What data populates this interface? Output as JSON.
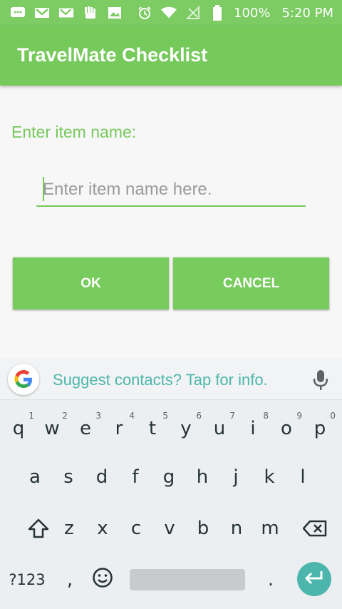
{
  "status_bar": {
    "battery_percent": "100%",
    "time": "5:20 PM",
    "icons": [
      "message-icon",
      "gmail-icon",
      "gmail-icon",
      "hand-icon",
      "image-icon",
      "alarm-icon",
      "wifi-icon",
      "no-signal-icon",
      "battery-icon"
    ]
  },
  "app_bar": {
    "title": "TravelMate Checklist"
  },
  "form": {
    "label": "Enter item name:",
    "input_placeholder": "Enter item name here.",
    "input_value": "",
    "ok_label": "OK",
    "cancel_label": "CANCEL"
  },
  "keyboard": {
    "suggestion": "Suggest contacts? Tap for info.",
    "row1": [
      "q",
      "w",
      "e",
      "r",
      "t",
      "y",
      "u",
      "i",
      "o",
      "p"
    ],
    "row1_hints": [
      "1",
      "2",
      "3",
      "4",
      "5",
      "6",
      "7",
      "8",
      "9",
      "0"
    ],
    "row2": [
      "a",
      "s",
      "d",
      "f",
      "g",
      "h",
      "j",
      "k",
      "l"
    ],
    "row3": [
      "z",
      "x",
      "c",
      "v",
      "b",
      "n",
      "m"
    ],
    "symbols_label": "?123",
    "comma": ",",
    "period": "."
  },
  "colors": {
    "status_bar": "#7ccb63",
    "app_bar": "#76c95b",
    "accent": "#76c95b",
    "keyboard_accent": "#4db6ac"
  }
}
